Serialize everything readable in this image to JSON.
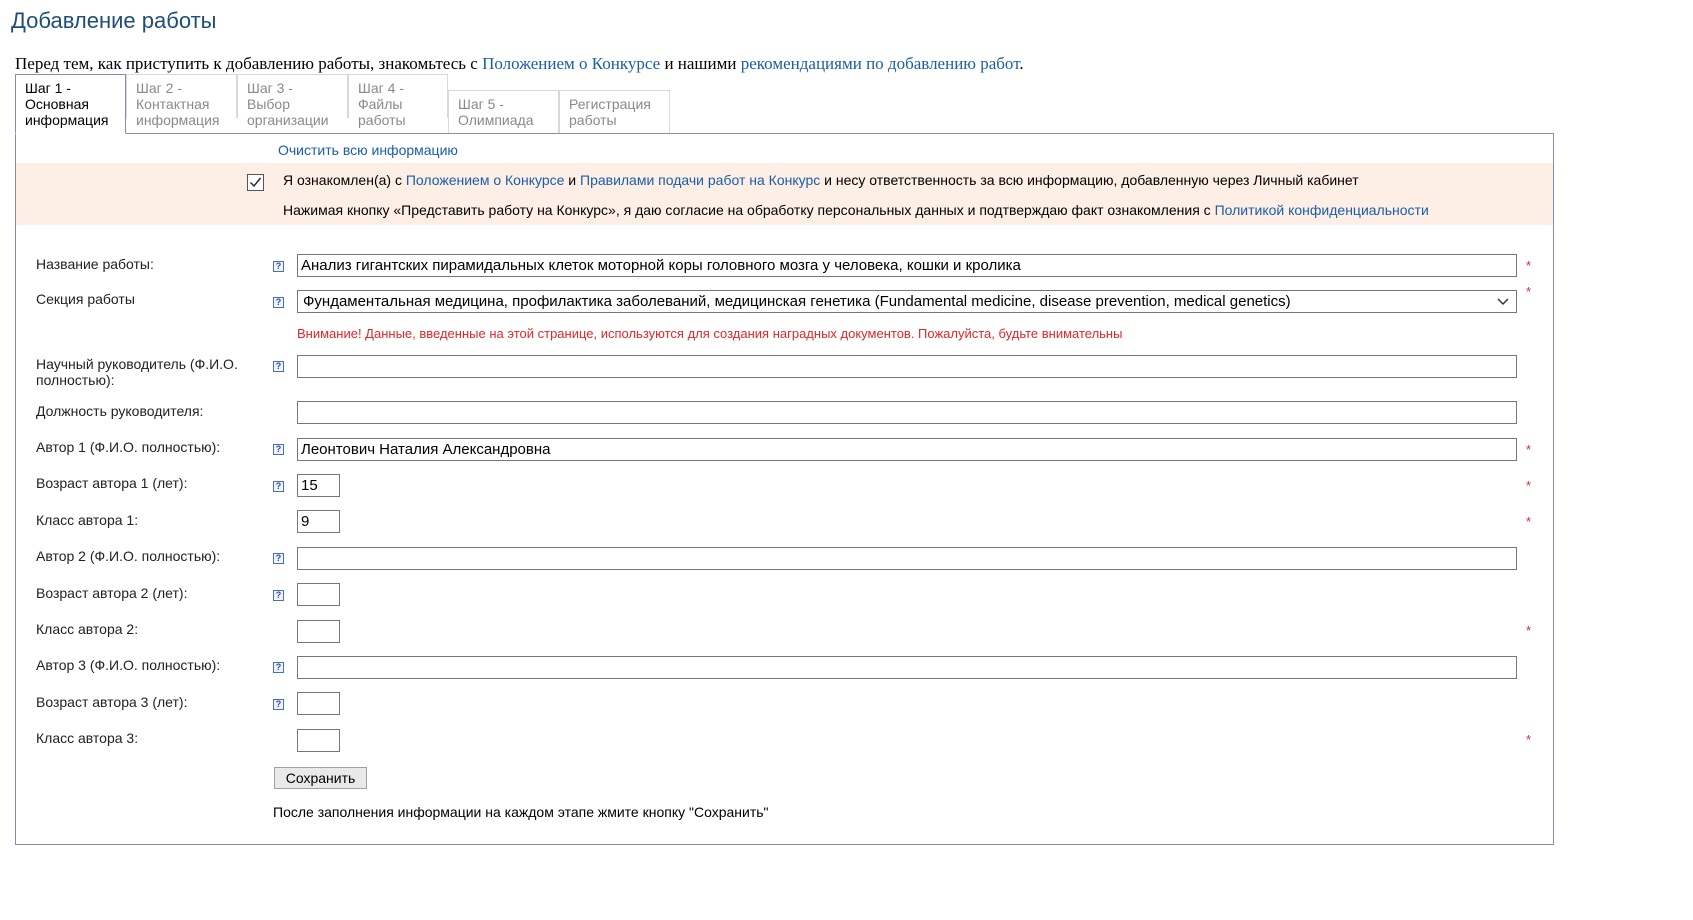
{
  "page_title": "Добавление работы",
  "intro": {
    "text_before": "Перед тем, как приступить к добавлению работы, знакомьтесь с ",
    "link1": "Положением о Конкурсе",
    "text_middle": " и нашими ",
    "link2": "рекомендациями по добавлению работ",
    "text_after": "."
  },
  "tabs": [
    {
      "label": "Шаг 1 - Основная информация"
    },
    {
      "label": "Шаг 2 - Контактная информация"
    },
    {
      "label": "Шаг 3 - Выбор организации"
    },
    {
      "label": "Шаг 4 - Файлы работы"
    },
    {
      "label": "Шаг 5 - Олимпиада"
    },
    {
      "label": "Регистрация работы"
    }
  ],
  "clear_link": "Очистить всю информацию",
  "agreement": {
    "checked": true,
    "t1": "Я ознакомлен(а) с ",
    "l1": "Положением о Конкурсе",
    "t2": " и ",
    "l2": "Правилами подачи работ на Конкурс",
    "t3": " и несу ответственность за всю информацию, добавленную через Личный кабинет",
    "t4": "Нажимая кнопку «Представить работу на Конкурс», я даю согласие на обработку персональных данных и подтверждаю факт ознакомления с ",
    "l3": "Политикой конфиденциальности"
  },
  "form": {
    "title_label": "Название работы:",
    "title_value": "Анализ гигантских пирамидальных клеток моторной коры головного мозга у человека, кошки и кролика",
    "section_label": "Секция работы",
    "section_value": "Фундаментальная медицина, профилактика заболеваний, медицинская генетика (Fundamental medicine, disease prevention, medical genetics)",
    "warning": "Внимание! Данные, введенные на этой странице, используются для создания наградных документов. Пожалуйста, будьте внимательны",
    "supervisor_label": "Научный руководитель (Ф.И.О. полностью):",
    "supervisor_value": "",
    "position_label": "Должность руководителя:",
    "position_value": "",
    "author1_label": "Автор 1 (Ф.И.О. полностью):",
    "author1_value": "Леонтович Наталия Александровна",
    "age1_label": "Возраст автора 1 (лет):",
    "age1_value": "15",
    "class1_label": "Класс автора 1:",
    "class1_value": "9",
    "author2_label": "Автор 2 (Ф.И.О. полностью):",
    "author2_value": "",
    "age2_label": "Возраст автора 2 (лет):",
    "age2_value": "",
    "class2_label": "Класс автора 2:",
    "class2_value": "",
    "author3_label": "Автор 3 (Ф.И.О. полностью):",
    "author3_value": "",
    "age3_label": "Возраст автора 3 (лет):",
    "age3_value": "",
    "class3_label": "Класс автора 3:",
    "class3_value": "",
    "help_glyph": "?",
    "required_mark": "*",
    "save_label": "Сохранить",
    "after_note": "После заполнения информации на каждом этапе жмите кнопку \"Сохранить\""
  },
  "colors": {
    "accent": "#1a5ea8",
    "title": "#1f4e79",
    "warning": "#e0262b",
    "agree_bg": "#fdeee6"
  }
}
